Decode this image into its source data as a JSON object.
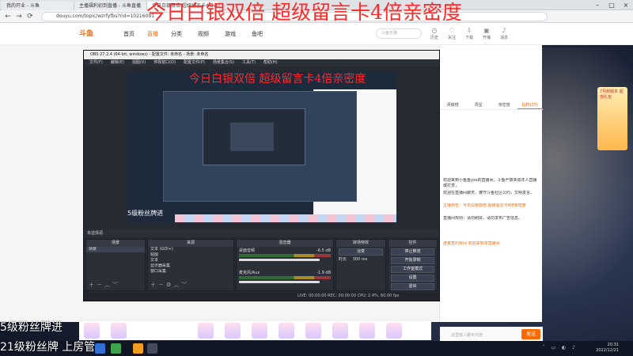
{
  "browser": {
    "tabs": [
      "我的开业 - 斗鱼",
      "主播福利初到直播 - 斗鱼直播",
      "今日白银双倍 超级留言卡4倍亲密度"
    ],
    "url": "douyu.com/topic/wzrfyfbs?rid=10216091"
  },
  "overlay": {
    "title": "今日白银双倍  超级留言卡4倍亲密度",
    "fans_line1": "5级粉丝牌进",
    "fans_line2": "21级粉丝牌 上房管"
  },
  "site": {
    "logo": "斗鱼",
    "nav": [
      "首页",
      "直播",
      "分类",
      "视频",
      "游戏",
      "鱼吧"
    ],
    "search_placeholder": "斗鱼无畏",
    "icons": [
      "历史",
      "关注",
      "下载",
      "开播",
      "消息"
    ]
  },
  "obs": {
    "title": "OBS 27.2.4 (64-bit, windows) - 配置文件: 未命名 - 场景: 未命名",
    "menu": [
      "文件(F)",
      "编辑(E)",
      "视图(V)",
      "停靠窗口(D)",
      "配置文件(P)",
      "场景集合(S)",
      "工具(T)",
      "帮助(H)"
    ],
    "preview_title": "今日白银双倍  超级留言卡4倍亲密度",
    "preview_fans": "5级粉丝牌进",
    "studio_label": "未选择源",
    "docks": {
      "scenes": {
        "title": "场景",
        "items": [
          "场景"
        ]
      },
      "sources": {
        "title": "来源",
        "items": [
          "文本 (GDI+)",
          "贴图",
          "文本",
          "显示器采集",
          "窗口采集"
        ]
      },
      "mixer": {
        "title": "混音器",
        "tracks": [
          {
            "name": "桌面音频",
            "db": "-6.5 dB"
          },
          {
            "name": "麦克风/Aux",
            "db": "-1.9 dB"
          }
        ]
      },
      "transitions": {
        "title": "转场特效",
        "type": "淡变",
        "duration_label": "时长",
        "duration": "300 ms"
      },
      "controls": {
        "title": "控件",
        "buttons": [
          "停止推流",
          "开始录制",
          "工作室模式",
          "设置",
          "退出"
        ]
      }
    },
    "status": "LIVE: 00:00:00   REC: 00:00:00   CPU: 2.4%, 60.00 fps"
  },
  "chat": {
    "tabs": [
      "贡献榜",
      "周星",
      "亲密度",
      "钻粉(35)"
    ],
    "lines": [
      "欢迎来到小鱼鱼yxs的直播间，斗鱼严禁未成年人直播或打赏，",
      "欢迎在直播间聊天，遵守斗鱼社区公约，文明发言。",
      "主播预告：今日白银双倍 超级留言卡4倍亲密度",
      "直播间规则：请勿刷屏，请勿发布广告信息。",
      "连麦签约房间 欢迎来到本直播间"
    ],
    "input_placeholder": "这里输入聊天内容",
    "send_label": "发送"
  },
  "side_ad": "7月新版本 超值礼包",
  "taskbar": {
    "time": "20:31",
    "date": "2022/12/21"
  }
}
